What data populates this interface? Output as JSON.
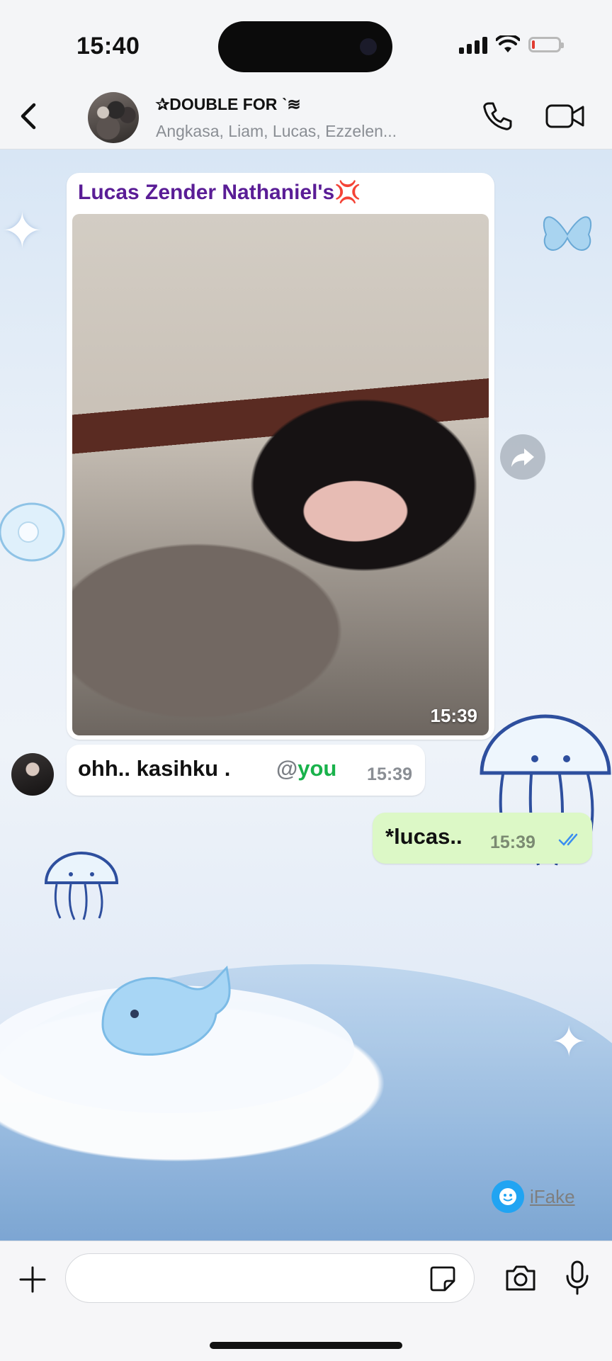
{
  "status_bar": {
    "time": "15:40",
    "battery_level": 0.08,
    "signal_bars": 4
  },
  "header": {
    "back_icon": "chevron-left-icon",
    "title": "✰DOUBLE FOR ˋ≋",
    "members": "Angkasa, Liam, Lucas, Ezzelen...",
    "call_icon": "phone-icon",
    "video_icon": "video-camera-icon"
  },
  "messages": [
    {
      "type": "image",
      "sender": "Lucas Zender Nathaniel's💢",
      "time": "15:39",
      "forward_icon": "forward-icon"
    },
    {
      "type": "text",
      "direction": "incoming",
      "text": "ohh.. kasihku .",
      "mention_at": "@",
      "mention_name": "you",
      "time": "15:39"
    },
    {
      "type": "text",
      "direction": "outgoing",
      "text": "*lucas..",
      "time": "15:39",
      "status": "read",
      "status_icon": "double-check-icon"
    }
  ],
  "watermark": {
    "text": "iFake"
  },
  "input_bar": {
    "plus_icon": "plus-icon",
    "placeholder": "",
    "sticker_icon": "sticker-icon",
    "camera_icon": "camera-icon",
    "mic_icon": "microphone-icon"
  },
  "colors": {
    "accent_green": "#19b24b",
    "outgoing_bubble": "#dcf8c6",
    "sender_name": "#5a1d96",
    "read_ticks": "#3b8ef0"
  }
}
